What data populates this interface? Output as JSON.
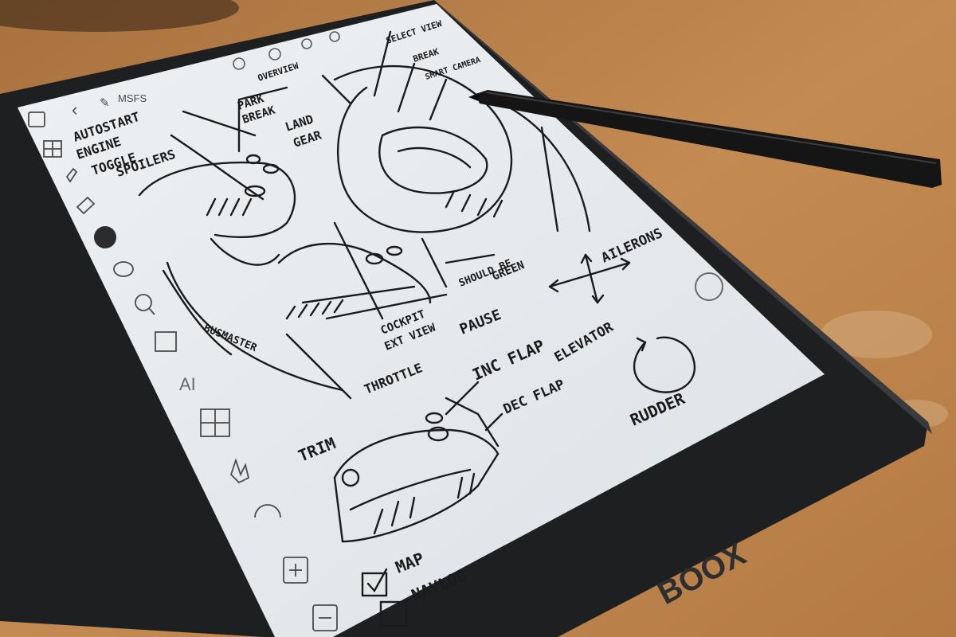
{
  "colors": {
    "desk": "#b9814a",
    "desk_dark": "#8a5a2c",
    "bezel": "#1e1f21",
    "screen": "#e7ebee",
    "ink": "#1b1b1b",
    "stylus": "#151515"
  },
  "device": {
    "brand": "BOOX",
    "notebook_title": "MSFS",
    "top_icons": [
      "home-icon",
      "search-icon",
      "share-icon",
      "settings-icon"
    ]
  },
  "toolbar": {
    "icons": [
      "fullscreen-icon",
      "grid-icon",
      "pen-icon",
      "eraser-icon",
      "color-dot-icon",
      "lasso-icon",
      "zoom-icon",
      "text-box-icon",
      "ai-icon",
      "layout-icon",
      "hand-icon",
      "refresh-icon",
      "add-page-icon",
      "remove-page-icon"
    ],
    "ai_label": "AI"
  },
  "sketch": {
    "labels": {
      "autostart": "AUTOSTART",
      "engine": "ENGINE",
      "toggle": "TOGGLE",
      "spoilers": "SPOILERS",
      "park": "PARK",
      "break": "BREAK",
      "land": "LAND",
      "gear": "GEAR",
      "overview": "OVERVIEW",
      "select_view": "SELECT VIEW",
      "break_top": "BREAK",
      "smart_camera": "SMART CAMERA",
      "cockpit": "COCKPIT",
      "ext_view": "EXT VIEW",
      "should_be": "SHOULD BE",
      "green": "GREEN",
      "pause": "PAUSE",
      "ailerons": "AILERONS",
      "inc_flap": "INC FLAP",
      "elevator": "ELEVATOR",
      "dec_flap": "DEC FLAP",
      "throttle": "THROTTLE",
      "busmaster": "BUSMASTER",
      "trim": "TRIM",
      "rudder": "RUDDER",
      "map": "MAP",
      "navlog": "NAVLOG"
    }
  }
}
